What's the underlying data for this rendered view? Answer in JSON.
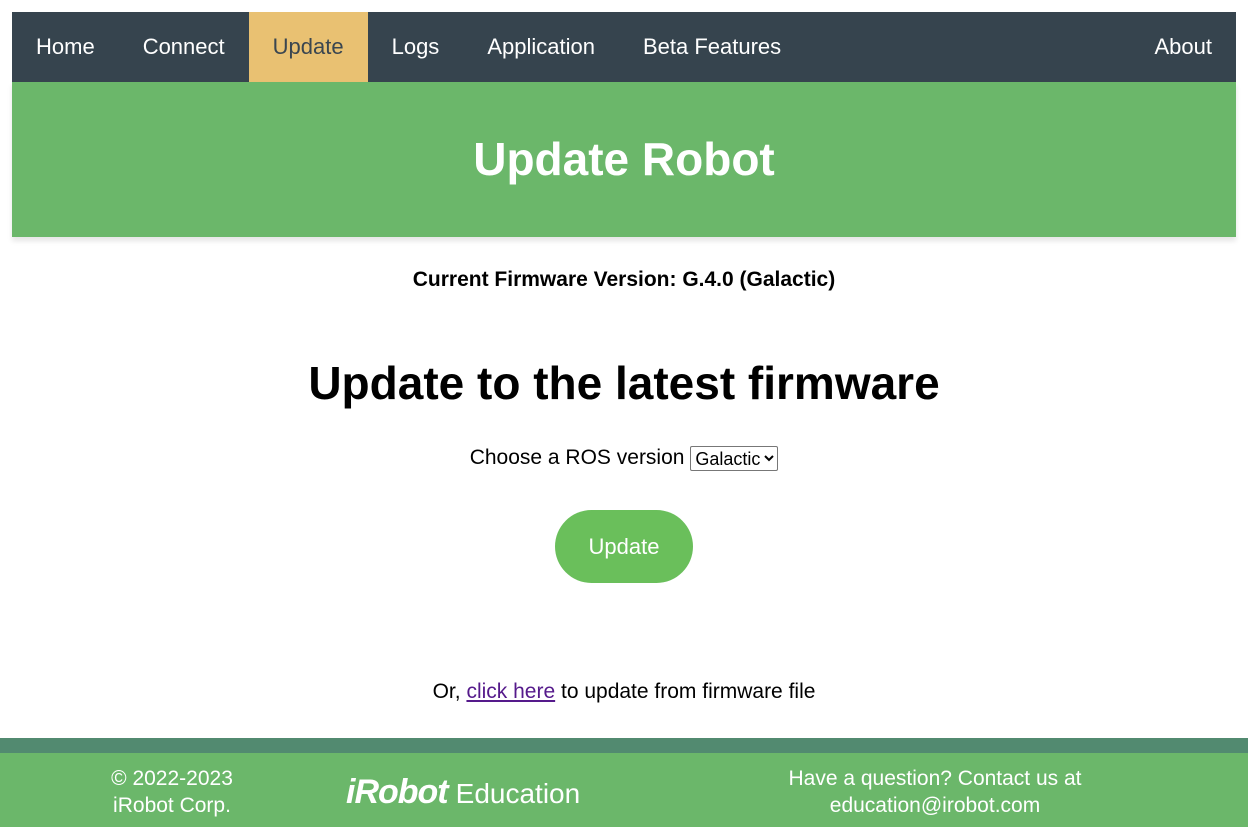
{
  "nav": {
    "items": [
      {
        "label": "Home"
      },
      {
        "label": "Connect"
      },
      {
        "label": "Update",
        "active": true
      },
      {
        "label": "Logs"
      },
      {
        "label": "Application"
      },
      {
        "label": "Beta Features"
      }
    ],
    "about": "About"
  },
  "hero": {
    "title": "Update Robot"
  },
  "firmware": {
    "current": "Current Firmware Version: G.4.0 (Galactic)"
  },
  "main": {
    "heading": "Update to the latest firmware",
    "choose_label": "Choose a ROS version",
    "ros_selected": "Galactic",
    "update_button": "Update",
    "or_prefix": "Or,",
    "link": "click here",
    "or_suffix": "to update from firmware file"
  },
  "footer": {
    "copyright": "© 2022-2023",
    "company": "iRobot Corp.",
    "logo_brand": "iRobot",
    "logo_suffix": "Education",
    "question": "Have a question? Contact us at",
    "email": "education@irobot.com"
  },
  "colors": {
    "nav": "#36444e",
    "active": "#e9c172",
    "green": "#6bb76a",
    "button": "#6abf5b"
  }
}
